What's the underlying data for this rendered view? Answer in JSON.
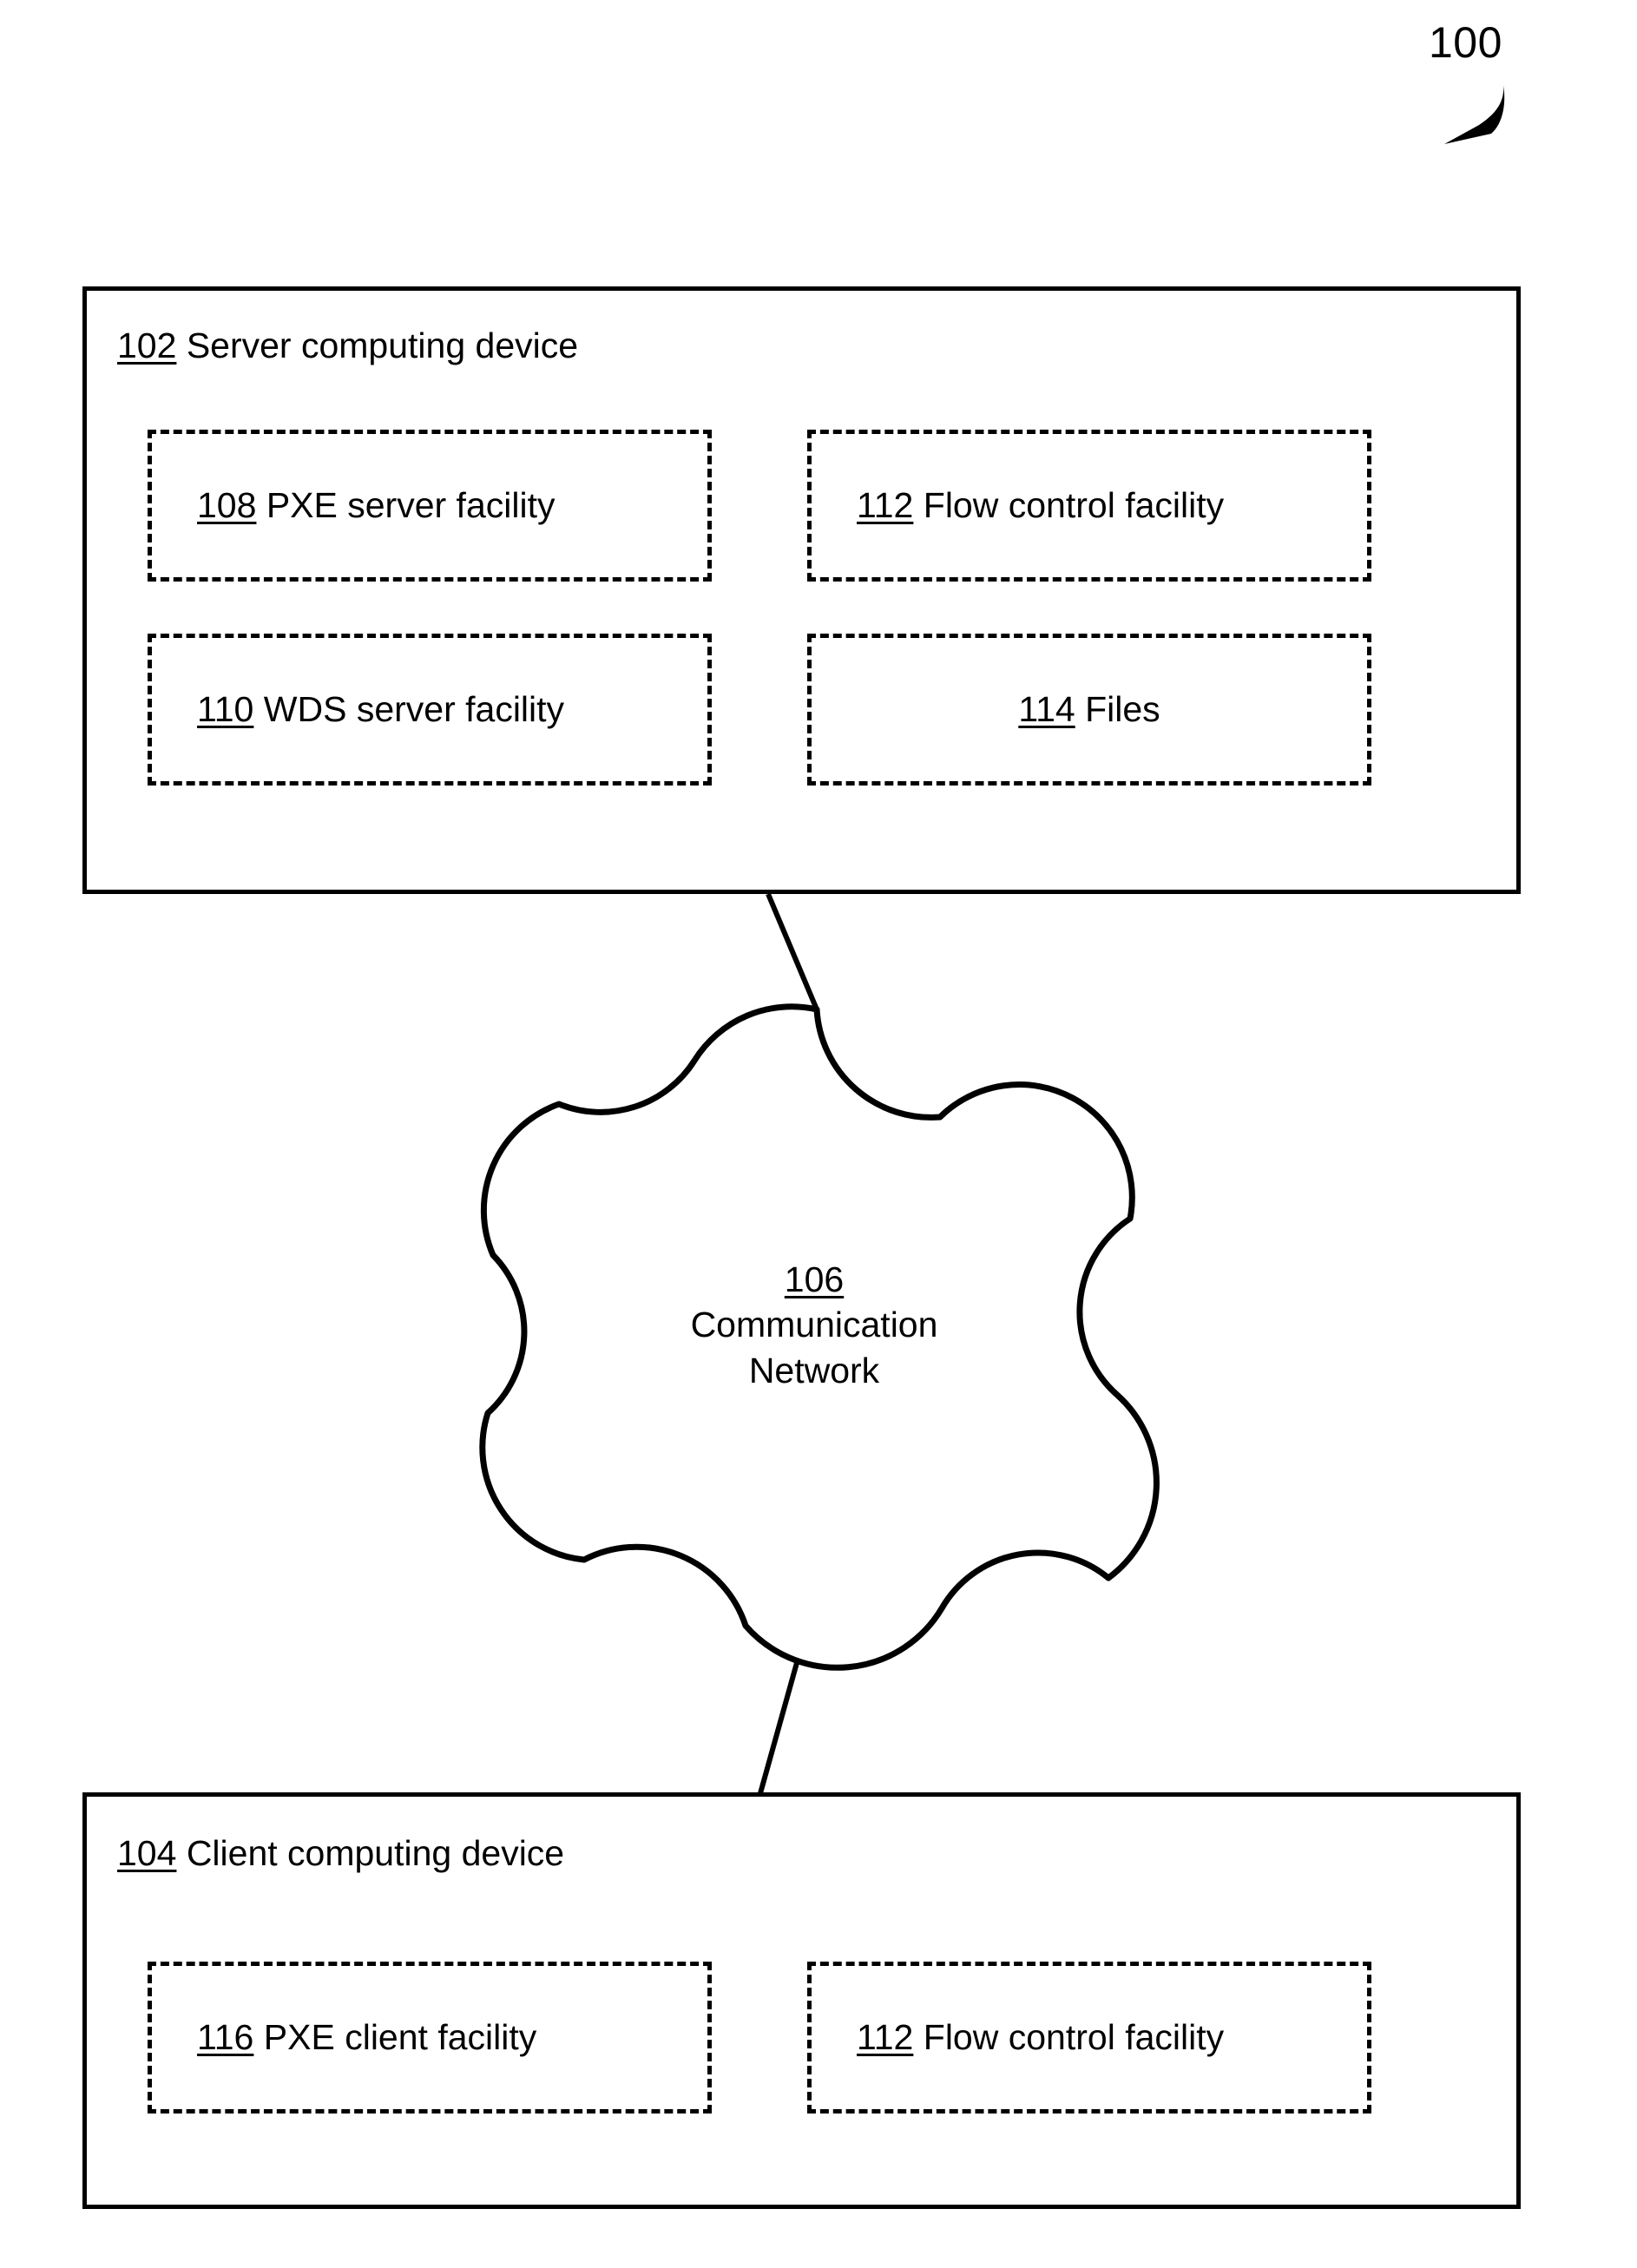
{
  "figure": {
    "number": "100",
    "arrow_icon": "curved-arrow-down-left-icon"
  },
  "server": {
    "ref": "102",
    "title": "Server computing device",
    "facilities": [
      {
        "ref": "108",
        "label": "PXE server facility",
        "align": "left"
      },
      {
        "ref": "112",
        "label": "Flow control facility",
        "align": "left"
      },
      {
        "ref": "110",
        "label": "WDS server facility",
        "align": "left"
      },
      {
        "ref": "114",
        "label": "Files",
        "align": "center"
      }
    ]
  },
  "network": {
    "ref": "106",
    "line1": "Communication",
    "line2": "Network",
    "shape": "cloud-icon"
  },
  "client": {
    "ref": "104",
    "title": "Client computing device",
    "facilities": [
      {
        "ref": "116",
        "label": "PXE client facility",
        "align": "left"
      },
      {
        "ref": "112",
        "label": "Flow control facility",
        "align": "left"
      }
    ]
  },
  "connectors": [
    {
      "name": "server-to-network-link"
    },
    {
      "name": "network-to-client-link"
    }
  ],
  "colors": {
    "stroke": "#000000",
    "background": "#ffffff"
  }
}
